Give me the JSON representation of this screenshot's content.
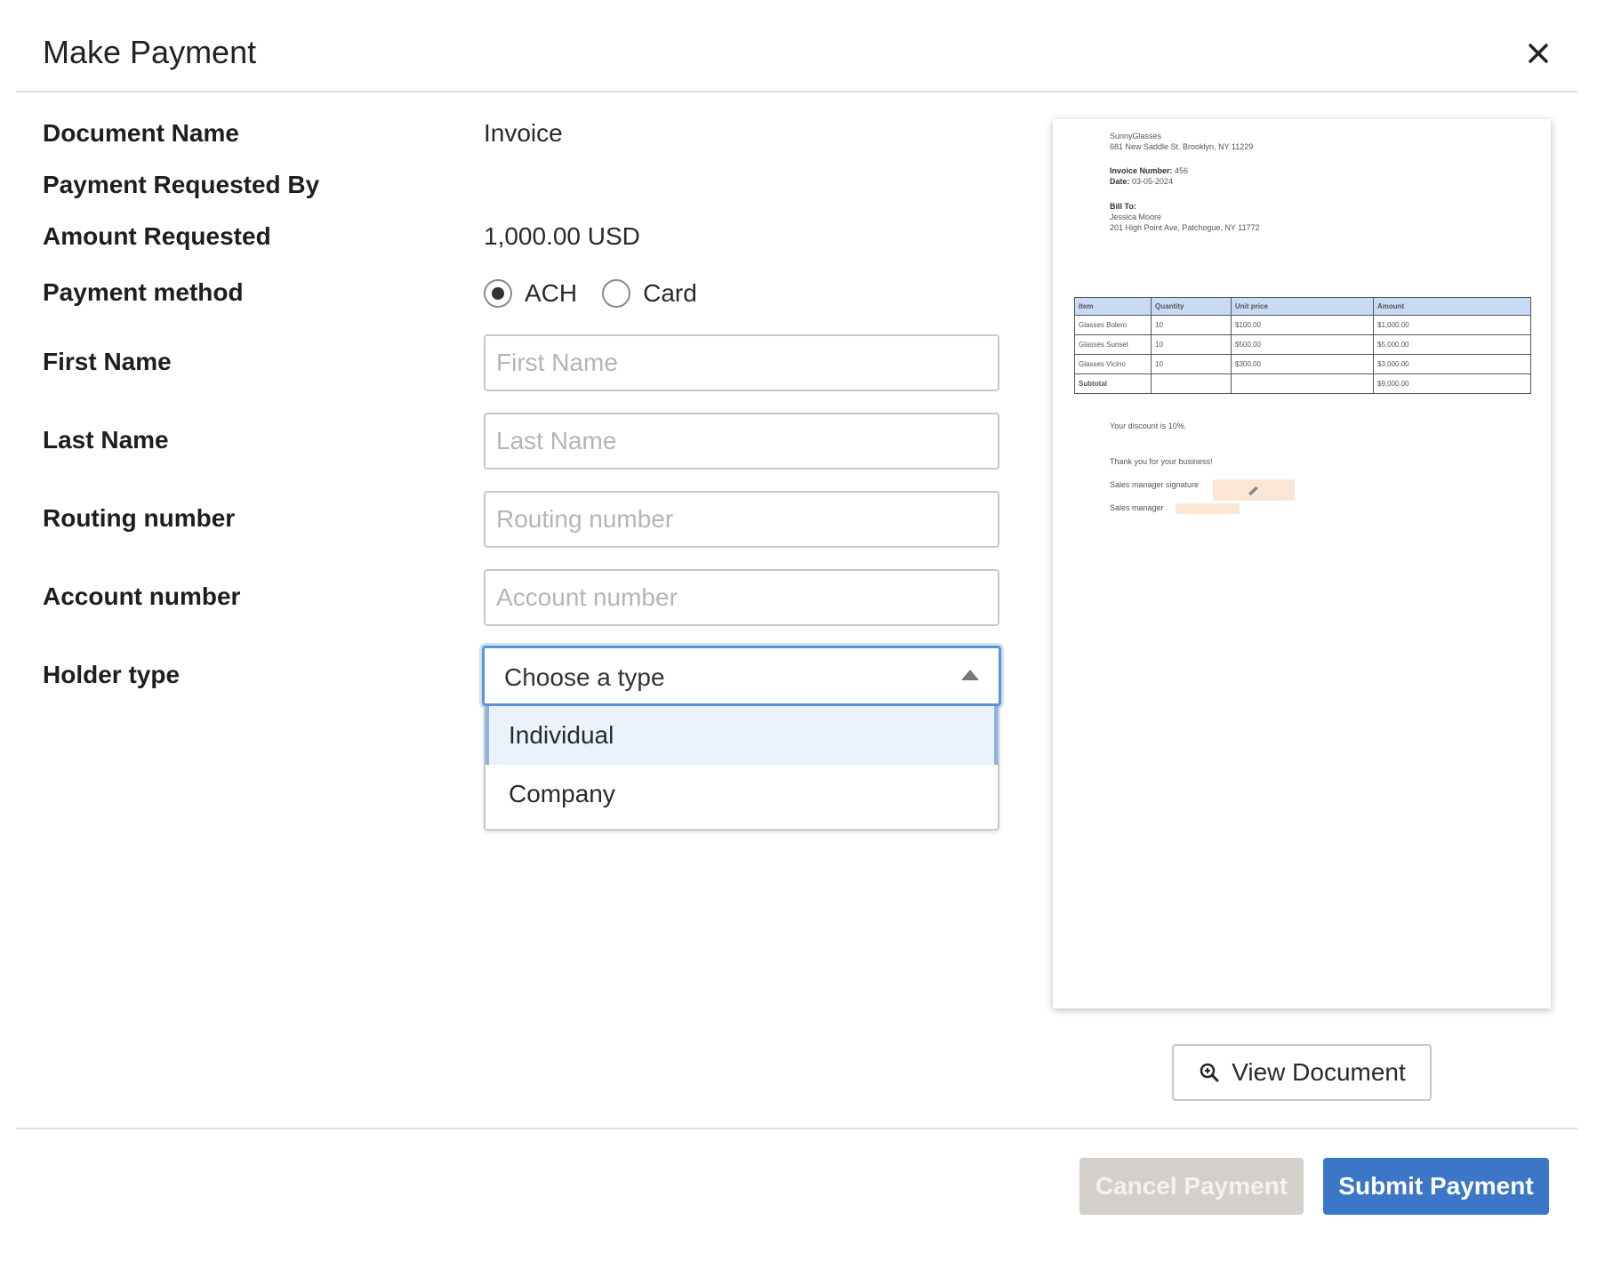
{
  "header": {
    "title": "Make Payment"
  },
  "form": {
    "document_name_label": "Document Name",
    "document_name_value": "Invoice",
    "requested_by_label": "Payment Requested By",
    "requested_by_value": "",
    "amount_label": "Amount Requested",
    "amount_value": "1,000.00 USD",
    "payment_method_label": "Payment method",
    "payment_methods": [
      {
        "label": "ACH",
        "selected": true
      },
      {
        "label": "Card",
        "selected": false
      }
    ],
    "first_name_label": "First Name",
    "first_name_placeholder": "First Name",
    "last_name_label": "Last Name",
    "last_name_placeholder": "Last Name",
    "routing_label": "Routing number",
    "routing_placeholder": "Routing number",
    "account_label": "Account number",
    "account_placeholder": "Account number",
    "holder_type_label": "Holder type",
    "holder_type_value": "Choose a type",
    "holder_type_options": [
      "Individual",
      "Company"
    ]
  },
  "document_preview": {
    "company_name": "SunnyGlasses",
    "company_address": "681 New Saddle St. Brooklyn, NY 11229",
    "invoice_number_label": "Invoice Number:",
    "invoice_number": "456",
    "date_label": "Date:",
    "date": "03-05-2024",
    "bill_to_label": "Bill To:",
    "bill_to_name": "Jessica Moore",
    "bill_to_address": "201 High Point Ave, Patchogue, NY 11772",
    "table_headers": [
      "Item",
      "Quantity",
      "Unit price",
      "Amount"
    ],
    "table_rows": [
      [
        "Glasses Bolero",
        "10",
        "$100.00",
        "$1,000.00"
      ],
      [
        "Glasses Sunset",
        "10",
        "$500.00",
        "$5,000.00"
      ],
      [
        "Glasses Vicino",
        "10",
        "$300.00",
        "$3,000.00"
      ],
      [
        "Subtotal",
        "",
        "",
        "$9,000.00"
      ]
    ],
    "discount_text": "Your discount is 10%.",
    "thanks_text": "Thank you for your business!",
    "signature_label": "Sales manager signature",
    "manager_label": "Sales manager",
    "view_button_label": "View Document"
  },
  "footer": {
    "cancel_label": "Cancel Payment",
    "submit_label": "Submit Payment"
  },
  "colors": {
    "accent": "#3b77c6",
    "focus_ring": "#5b93d6",
    "highlight": "#eaf2fc",
    "disabled_button": "#d3cfcb"
  }
}
